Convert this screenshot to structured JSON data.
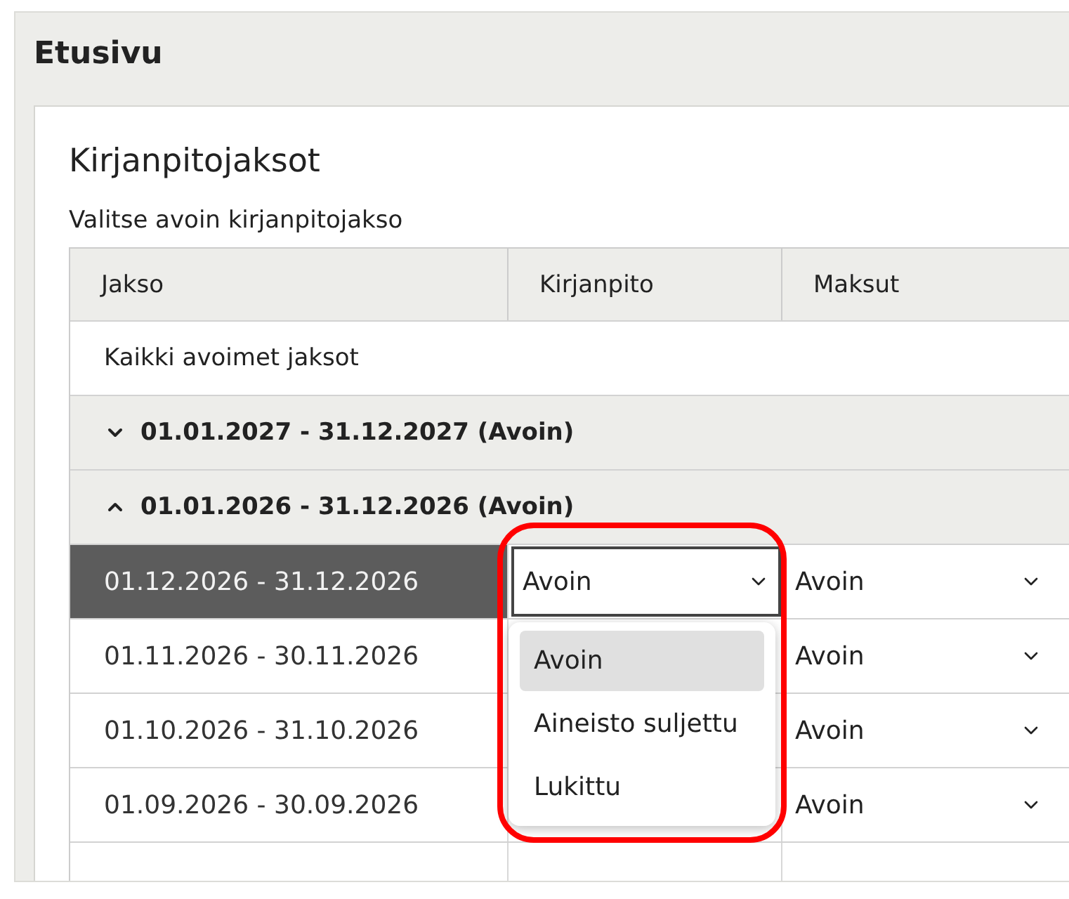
{
  "page": {
    "title": "Etusivu"
  },
  "panel": {
    "title": "Kirjanpitojaksot",
    "subtitle": "Valitse avoin kirjanpitojakso"
  },
  "table": {
    "columns": [
      "Jakso",
      "Kirjanpito",
      "Maksut"
    ],
    "all_row": "Kaikki avoimet jaksot",
    "groups": [
      {
        "label": "01.01.2027 - 31.12.2027 (Avoin)",
        "expanded": false
      },
      {
        "label": "01.01.2026 - 31.12.2026 (Avoin)",
        "expanded": true,
        "rows": [
          {
            "period": "01.12.2026 - 31.12.2026",
            "selected": true,
            "kirjanpito": "Avoin",
            "maksut": "Avoin"
          },
          {
            "period": "01.11.2026 - 30.11.2026",
            "selected": false,
            "maksut": "Avoin"
          },
          {
            "period": "01.10.2026 - 31.10.2026",
            "selected": false,
            "maksut": "Avoin"
          },
          {
            "period": "01.09.2026 - 30.09.2026",
            "selected": false,
            "maksut": "Avoin"
          }
        ]
      }
    ]
  },
  "dropdown": {
    "options": [
      {
        "label": "Avoin",
        "selected": true
      },
      {
        "label": "Aineisto suljettu",
        "selected": false
      },
      {
        "label": "Lukittu",
        "selected": false
      }
    ]
  }
}
